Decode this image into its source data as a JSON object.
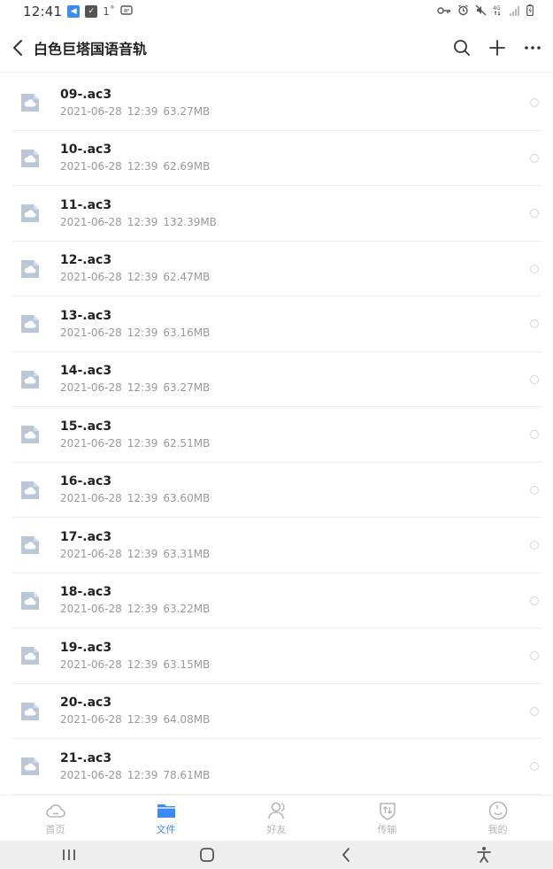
{
  "status_bar": {
    "time": "12:41",
    "indicator": "1˚"
  },
  "header": {
    "title": "白色巨塔国语音轨"
  },
  "files": [
    {
      "name": "09-.ac3",
      "date": "2021-06-28",
      "time": "12:39",
      "size": "63.27MB"
    },
    {
      "name": "10-.ac3",
      "date": "2021-06-28",
      "time": "12:39",
      "size": "62.69MB"
    },
    {
      "name": "11-.ac3",
      "date": "2021-06-28",
      "time": "12:39",
      "size": "132.39MB"
    },
    {
      "name": "12-.ac3",
      "date": "2021-06-28",
      "time": "12:39",
      "size": "62.47MB"
    },
    {
      "name": "13-.ac3",
      "date": "2021-06-28",
      "time": "12:39",
      "size": "63.16MB"
    },
    {
      "name": "14-.ac3",
      "date": "2021-06-28",
      "time": "12:39",
      "size": "63.27MB"
    },
    {
      "name": "15-.ac3",
      "date": "2021-06-28",
      "time": "12:39",
      "size": "62.51MB"
    },
    {
      "name": "16-.ac3",
      "date": "2021-06-28",
      "time": "12:39",
      "size": "63.60MB"
    },
    {
      "name": "17-.ac3",
      "date": "2021-06-28",
      "time": "12:39",
      "size": "63.31MB"
    },
    {
      "name": "18-.ac3",
      "date": "2021-06-28",
      "time": "12:39",
      "size": "63.22MB"
    },
    {
      "name": "19-.ac3",
      "date": "2021-06-28",
      "time": "12:39",
      "size": "63.15MB"
    },
    {
      "name": "20-.ac3",
      "date": "2021-06-28",
      "time": "12:39",
      "size": "64.08MB"
    },
    {
      "name": "21-.ac3",
      "date": "2021-06-28",
      "time": "12:39",
      "size": "78.61MB"
    }
  ],
  "tabs": [
    {
      "label": "首页",
      "icon": "home-cloud-icon"
    },
    {
      "label": "文件",
      "icon": "folder-icon",
      "active": true
    },
    {
      "label": "好友",
      "icon": "friends-icon"
    },
    {
      "label": "传输",
      "icon": "transfer-icon"
    },
    {
      "label": "我的",
      "icon": "profile-icon"
    }
  ],
  "colors": {
    "accent": "#3d8bf2",
    "file_icon": "#b9c7d6",
    "inactive": "#b5b5b5"
  }
}
